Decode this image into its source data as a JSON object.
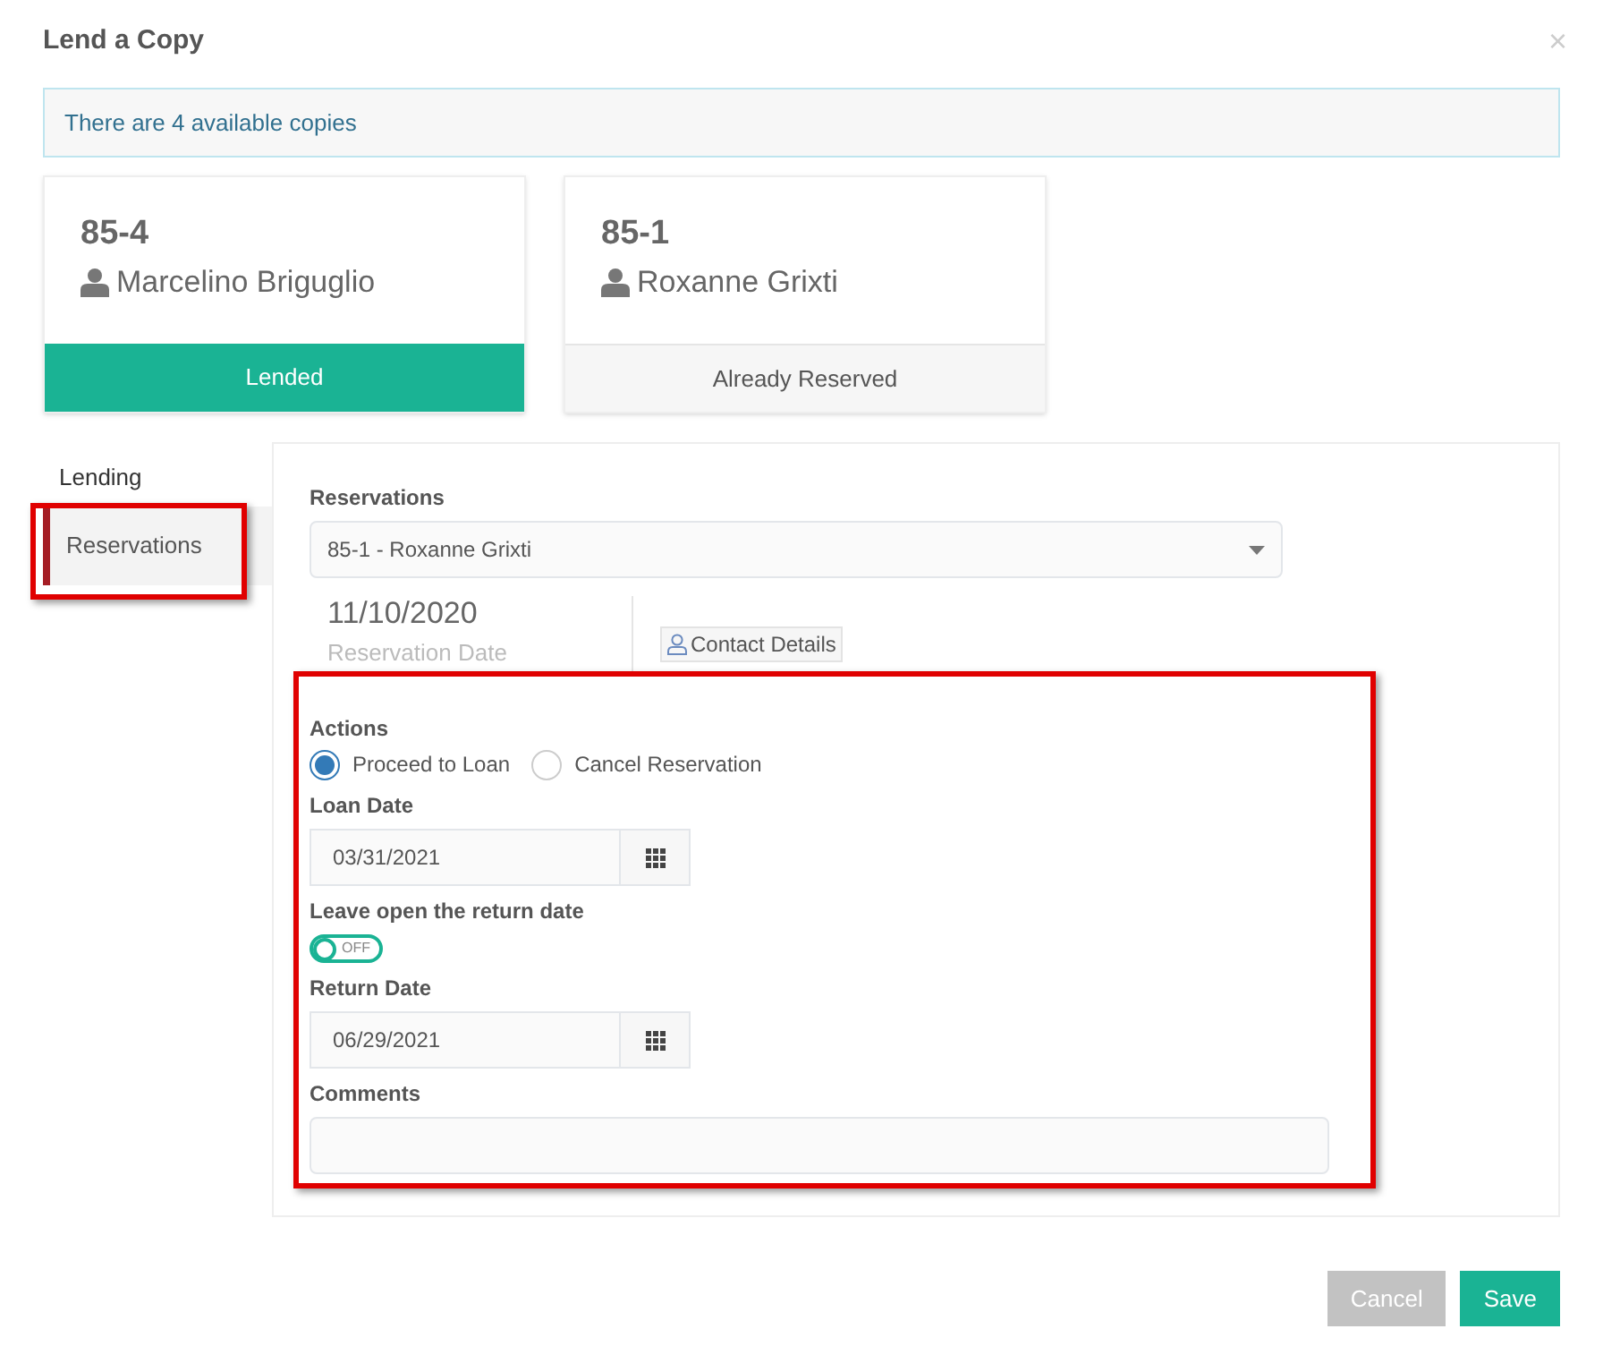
{
  "dialog": {
    "title": "Lend a Copy",
    "close": "×"
  },
  "alert": "There are 4 available copies",
  "copies": [
    {
      "code": "85-4",
      "person": "Marcelino Briguglio",
      "status": "Lended",
      "kind": "lended"
    },
    {
      "code": "85-1",
      "person": "Roxanne Grixti",
      "status": "Already Reserved",
      "kind": "reserved"
    }
  ],
  "tabs": [
    {
      "label": "Lending",
      "selected": false
    },
    {
      "label": "Reservations",
      "selected": true
    }
  ],
  "reservation": {
    "label": "Reservations",
    "value": "85-1 - Roxanne Grixti",
    "date": "11/10/2020",
    "date_caption": "Reservation Date",
    "contact_button": "Contact Details"
  },
  "actions": {
    "label": "Actions",
    "options": [
      {
        "label": "Proceed to Loan",
        "selected": true
      },
      {
        "label": "Cancel Reservation",
        "selected": false
      }
    ]
  },
  "loan_date": {
    "label": "Loan Date",
    "value": "03/31/2021"
  },
  "leave_open": {
    "label": "Leave open the return date",
    "on": false,
    "off_text": "OFF"
  },
  "return_date": {
    "label": "Return Date",
    "value": "06/29/2021"
  },
  "comments": {
    "label": "Comments"
  },
  "buttons": [
    {
      "label": "Cancel",
      "kind": "secondary"
    },
    {
      "label": "Save",
      "kind": "primary"
    }
  ]
}
